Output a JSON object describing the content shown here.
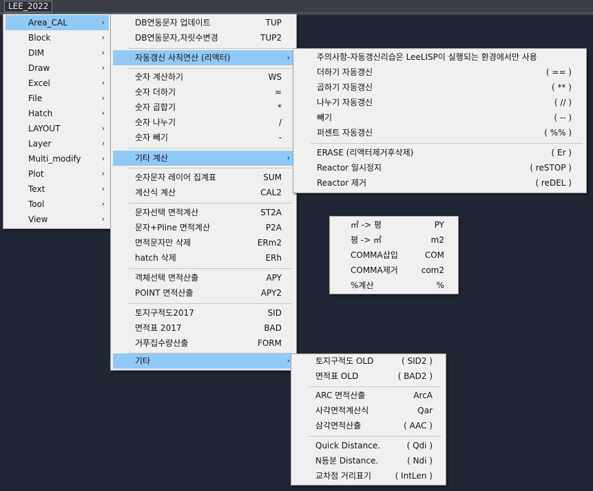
{
  "app": {
    "title": "LEE_2022"
  },
  "main_menu": [
    {
      "label": "Area_CAL"
    },
    {
      "label": "Block"
    },
    {
      "label": "DIM"
    },
    {
      "label": "Draw"
    },
    {
      "label": "Excel"
    },
    {
      "label": "File"
    },
    {
      "label": "Hatch"
    },
    {
      "label": "LAYOUT"
    },
    {
      "label": "Layer"
    },
    {
      "label": "Multi_modify"
    },
    {
      "label": "Plot"
    },
    {
      "label": "Text"
    },
    {
      "label": "Tool"
    },
    {
      "label": "View"
    }
  ],
  "area_cal_menu": [
    {
      "label": "DB연동문자 업데이트",
      "shortcut": "TUP"
    },
    {
      "label": "DB연동문자,자릿수변경",
      "shortcut": "TUP2"
    },
    {
      "label": "자동갱신 사칙연산 (리액터)",
      "shortcut": ""
    },
    {
      "label": "숫자 계산하기",
      "shortcut": "WS"
    },
    {
      "label": "숫자 더하기",
      "shortcut": "="
    },
    {
      "label": "숫자 곱합기",
      "shortcut": "*"
    },
    {
      "label": "숫자 나누기",
      "shortcut": "/"
    },
    {
      "label": "숫자 빼기",
      "shortcut": "-"
    },
    {
      "label": "기타 계산",
      "shortcut": ""
    },
    {
      "label": "숫자문자 레이어 집계표",
      "shortcut": "SUM"
    },
    {
      "label": "계산식 계산",
      "shortcut": "CAL2"
    },
    {
      "label": "문자선택 면적계산",
      "shortcut": "ST2A"
    },
    {
      "label": "문자+Pline 면적계산",
      "shortcut": "P2A"
    },
    {
      "label": "면적문자만 삭제",
      "shortcut": "ERm2"
    },
    {
      "label": "hatch 삭제",
      "shortcut": "ERh"
    },
    {
      "label": "객체선택 면적산출",
      "shortcut": "APY"
    },
    {
      "label": "POINT 면적산출",
      "shortcut": "APY2"
    },
    {
      "label": "토지구적도2017",
      "shortcut": "SID"
    },
    {
      "label": "면적표 2017",
      "shortcut": "BAD"
    },
    {
      "label": "거푸집수량산출",
      "shortcut": "FORM"
    },
    {
      "label": "기타",
      "shortcut": ""
    }
  ],
  "reactor_menu": [
    {
      "label": "주의사항-자동갱신리습은 LeeLISP이 실행되는 환경에서만 사용",
      "shortcut": ""
    },
    {
      "label": "더하기 자동갱신",
      "shortcut": "( == )"
    },
    {
      "label": "곱하기 자동갱신",
      "shortcut": "( ** )"
    },
    {
      "label": "나누기 자동갱신",
      "shortcut": "( // )"
    },
    {
      "label": "빼기",
      "shortcut": "( -- )"
    },
    {
      "label": "퍼센트 자동갱신",
      "shortcut": "( %% )"
    },
    {
      "label": "ERASE (리액터제거후삭제)",
      "shortcut": "( Er )"
    },
    {
      "label": "Reactor 일시정지",
      "shortcut": "( reSTOP )"
    },
    {
      "label": "Reactor 제거",
      "shortcut": "( reDEL )"
    }
  ],
  "calc_menu": [
    {
      "label": "㎡ -> 평",
      "shortcut": "PY"
    },
    {
      "label": "평 -> ㎡",
      "shortcut": "m2"
    },
    {
      "label": "COMMA삽입",
      "shortcut": "COM"
    },
    {
      "label": "COMMA제거",
      "shortcut": "com2"
    },
    {
      "label": "%계산",
      "shortcut": "%"
    }
  ],
  "etc_menu": [
    {
      "label": "토지구적도 OLD",
      "shortcut": "( SID2 )"
    },
    {
      "label": "면적표 OLD",
      "shortcut": "( BAD2 )"
    },
    {
      "label": "ARC 면적산출",
      "shortcut": "ArcA"
    },
    {
      "label": "사각면적계산식",
      "shortcut": "Qar"
    },
    {
      "label": "삼각면적산출",
      "shortcut": "( AAC )"
    },
    {
      "label": "Quick Distance.",
      "shortcut": "( Qdi )"
    },
    {
      "label": "N등분 Distance.",
      "shortcut": "( Ndi )"
    },
    {
      "label": "교차점 거리표기",
      "shortcut": "( IntLen )"
    }
  ],
  "submenu_arrow": "›"
}
